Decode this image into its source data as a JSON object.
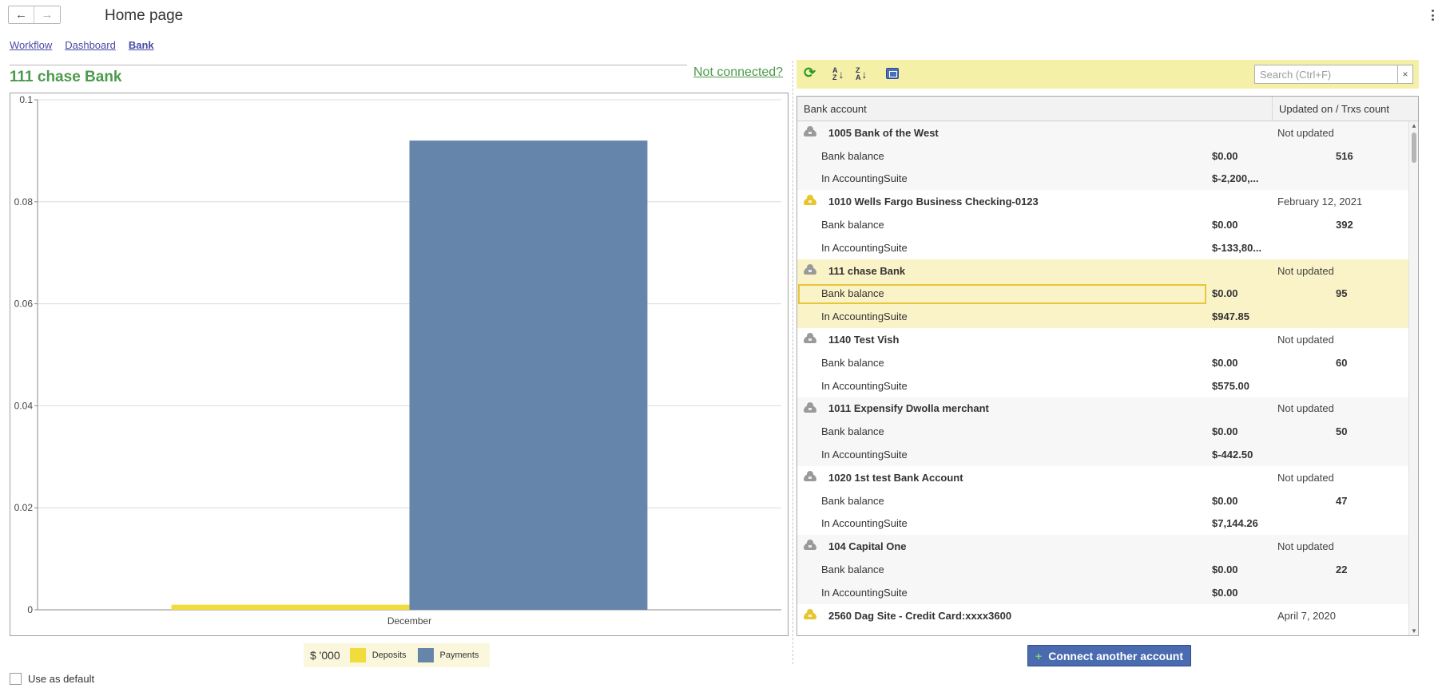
{
  "window": {
    "title": "Home page",
    "nav": {
      "back": "←",
      "forward": "→"
    }
  },
  "tabs": [
    {
      "label": "Workflow"
    },
    {
      "label": "Dashboard"
    },
    {
      "label": "Bank",
      "active": true
    }
  ],
  "left": {
    "bank_title": "111 chase Bank",
    "not_connected_link": "Not connected?",
    "use_as_default": "Use as default",
    "use_as_default_checked": false
  },
  "chart_data": {
    "type": "bar",
    "categories": [
      "December"
    ],
    "series": [
      {
        "name": "Deposits",
        "color": "#f0dc3c",
        "values": [
          0.001
        ]
      },
      {
        "name": "Payments",
        "color": "#6586aa",
        "values": [
          0.092
        ]
      }
    ],
    "ylim": [
      0,
      0.1
    ],
    "yticks": [
      "0",
      "0.02",
      "0.04",
      "0.06",
      "0.08",
      "0.1"
    ],
    "unit_label": "$ '000",
    "grid": true,
    "legend_placement": "bottom"
  },
  "right": {
    "toolbar": {
      "icons": [
        "refresh-icon",
        "sort-ascending-icon",
        "sort-descending-icon",
        "export-icon"
      ],
      "search_placeholder": "Search (Ctrl+F)",
      "clear_label": "×"
    },
    "columns": {
      "account": "Bank account",
      "updated": "Updated on / Trxs count"
    },
    "accounts": [
      {
        "name": "1005 Bank of the West",
        "status": "Not updated",
        "icon": "cloud-grey",
        "bank_balance_label": "Bank balance",
        "bank_balance": "$0.00",
        "count": "516",
        "in_as_label": "In AccountingSuite",
        "in_as": "$-2,200,..."
      },
      {
        "name": "1010 Wells Fargo Business Checking-0123",
        "status": "February 12, 2021",
        "icon": "cloud-gold",
        "bank_balance_label": "Bank balance",
        "bank_balance": "$0.00",
        "count": "392",
        "in_as_label": "In AccountingSuite",
        "in_as": "$-133,80..."
      },
      {
        "name": "111 chase Bank",
        "status": "Not updated",
        "icon": "cloud-grey",
        "bank_balance_label": "Bank balance",
        "bank_balance": "$0.00",
        "count": "95",
        "in_as_label": "In AccountingSuite",
        "in_as": "$947.85",
        "selected": true
      },
      {
        "name": "1140 Test Vish",
        "status": "Not updated",
        "icon": "cloud-grey",
        "bank_balance_label": "Bank balance",
        "bank_balance": "$0.00",
        "count": "60",
        "in_as_label": "In AccountingSuite",
        "in_as": "$575.00"
      },
      {
        "name": "1011 Expensify Dwolla merchant",
        "status": "Not updated",
        "icon": "cloud-grey",
        "bank_balance_label": "Bank balance",
        "bank_balance": "$0.00",
        "count": "50",
        "in_as_label": "In AccountingSuite",
        "in_as": "$-442.50"
      },
      {
        "name": "1020 1st test Bank Account",
        "status": "Not updated",
        "icon": "cloud-grey",
        "bank_balance_label": "Bank balance",
        "bank_balance": "$0.00",
        "count": "47",
        "in_as_label": "In AccountingSuite",
        "in_as": "$7,144.26"
      },
      {
        "name": "104 Capital One",
        "status": "Not updated",
        "icon": "cloud-grey",
        "bank_balance_label": "Bank balance",
        "bank_balance": "$0.00",
        "count": "22",
        "in_as_label": "In AccountingSuite",
        "in_as": "$0.00"
      },
      {
        "name": "2560 Dag Site - Credit Card:xxxx3600",
        "status": "April 7, 2020",
        "icon": "cloud-gold"
      }
    ],
    "connect_button": "Connect another account"
  }
}
